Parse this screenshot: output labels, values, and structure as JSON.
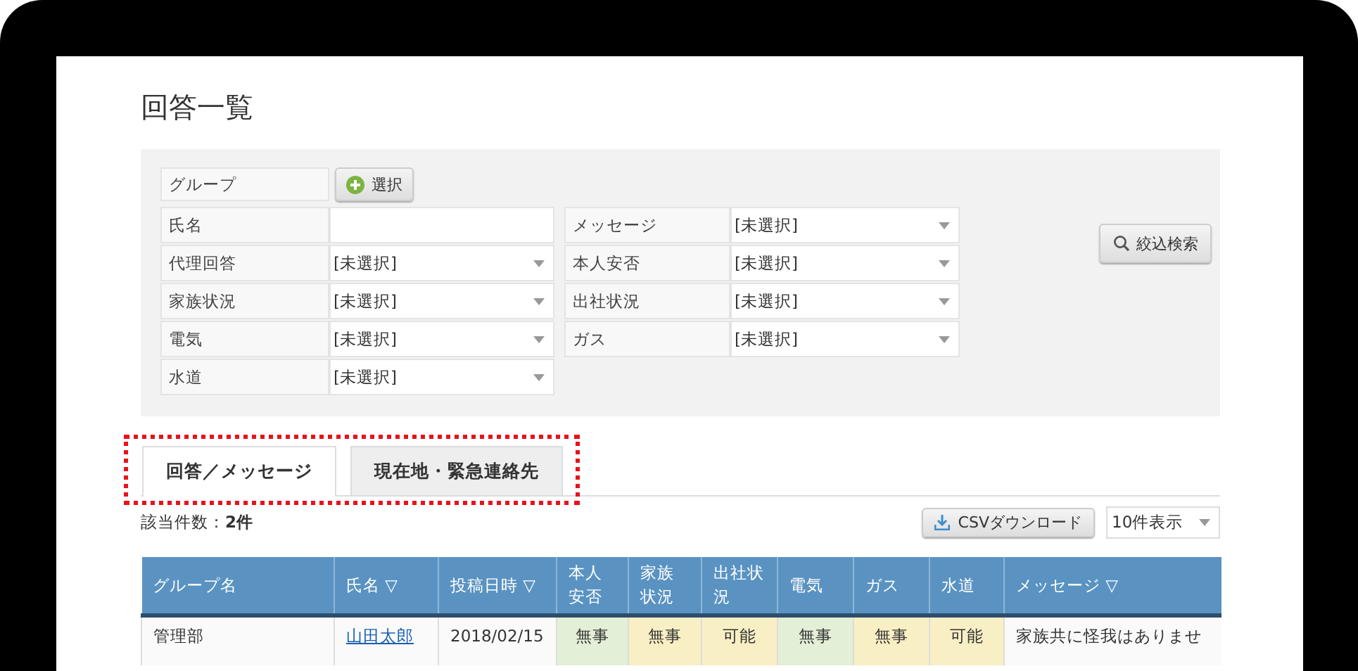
{
  "page_title": "回答一覧",
  "filters": {
    "left": [
      {
        "label": "グループ",
        "kind": "button",
        "button": "選択"
      },
      {
        "label": "氏名",
        "kind": "text"
      },
      {
        "label": "代理回答",
        "kind": "select",
        "value": "[未選択]"
      },
      {
        "label": "家族状況",
        "kind": "select",
        "value": "[未選択]"
      },
      {
        "label": "電気",
        "kind": "select",
        "value": "[未選択]"
      },
      {
        "label": "水道",
        "kind": "select",
        "value": "[未選択]"
      }
    ],
    "right": [
      {
        "label": "メッセージ",
        "kind": "select",
        "value": "[未選択]"
      },
      {
        "label": "本人安否",
        "kind": "select",
        "value": "[未選択]"
      },
      {
        "label": "出社状況",
        "kind": "select",
        "value": "[未選択]"
      },
      {
        "label": "ガス",
        "kind": "select",
        "value": "[未選択]"
      }
    ],
    "search_button": "絞込検索"
  },
  "tabs": {
    "highlighted": true,
    "items": [
      {
        "label": "回答／メッセージ",
        "selected": true
      },
      {
        "label": "現在地・緊急連絡先",
        "selected": false
      }
    ]
  },
  "result_count": "該当件数：**2件**",
  "csv_button": "CSVダウンロード",
  "page_size": "10件表示",
  "table": {
    "columns": [
      {
        "label": "グループ名"
      },
      {
        "label": "氏名",
        "sort_mark": "▽"
      },
      {
        "label": "投稿日時",
        "sort_mark": "▽"
      },
      {
        "label": "本人安否"
      },
      {
        "label": "家族状況"
      },
      {
        "label": "出社状況"
      },
      {
        "label": "電気"
      },
      {
        "label": "ガス"
      },
      {
        "label": "水道"
      },
      {
        "label": "メッセージ",
        "sort_mark": "▽"
      }
    ],
    "rows": [
      {
        "cells": [
          {
            "kind": "text",
            "text": "管理部"
          },
          {
            "kind": "link",
            "text": "山田太郎"
          },
          {
            "kind": "text",
            "text": "2018/02/15"
          },
          {
            "kind": "status",
            "text": "無事",
            "color": "#e3efd6"
          },
          {
            "kind": "status",
            "text": "無事",
            "color": "#f9efc4"
          },
          {
            "kind": "status",
            "text": "可能",
            "color": "#f9efc4"
          },
          {
            "kind": "status",
            "text": "無事",
            "color": "#e3efd6"
          },
          {
            "kind": "status",
            "text": "無事",
            "color": "#f9efc4"
          },
          {
            "kind": "status",
            "text": "可能",
            "color": "#f9efc4"
          },
          {
            "kind": "text",
            "text": "家族共に怪我はありませ"
          }
        ]
      }
    ]
  }
}
